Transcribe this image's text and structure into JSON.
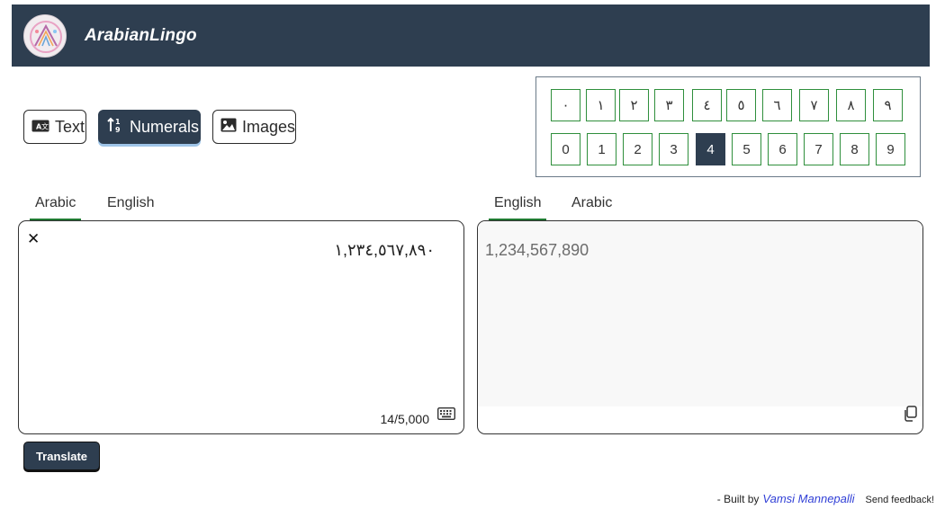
{
  "header": {
    "brand": "ArabianLingo"
  },
  "modes": [
    {
      "label": "Text",
      "icon": "language-card-icon"
    },
    {
      "label": "Numerals",
      "icon": "sort-numeric-icon",
      "active": true
    },
    {
      "label": "Images",
      "icon": "image-icon"
    }
  ],
  "keypad": {
    "arabic_digits": [
      "٠",
      "١",
      "٢",
      "٣",
      "٤",
      "٥",
      "٦",
      "٧",
      "٨",
      "٩"
    ],
    "western_digits": [
      "0",
      "1",
      "2",
      "3",
      "4",
      "5",
      "6",
      "7",
      "8",
      "9"
    ],
    "active": "4"
  },
  "source": {
    "tabs": [
      "Arabic",
      "English"
    ],
    "active_tab": "Arabic",
    "text": "١,٢٣٤,٥٦٧,٨٩٠",
    "counter": "14/5,000"
  },
  "target": {
    "tabs": [
      "English",
      "Arabic"
    ],
    "active_tab": "English",
    "text": "1,234,567,890"
  },
  "actions": {
    "translate_label": "Translate"
  },
  "footer": {
    "prefix": "- Built by",
    "author": "Vamsi Mannepalli",
    "feedback": "Send feedback!"
  },
  "colors": {
    "header_bg": "#2e3e50",
    "accent_green": "#1f7a32",
    "key_border": "#2f8f3c"
  }
}
